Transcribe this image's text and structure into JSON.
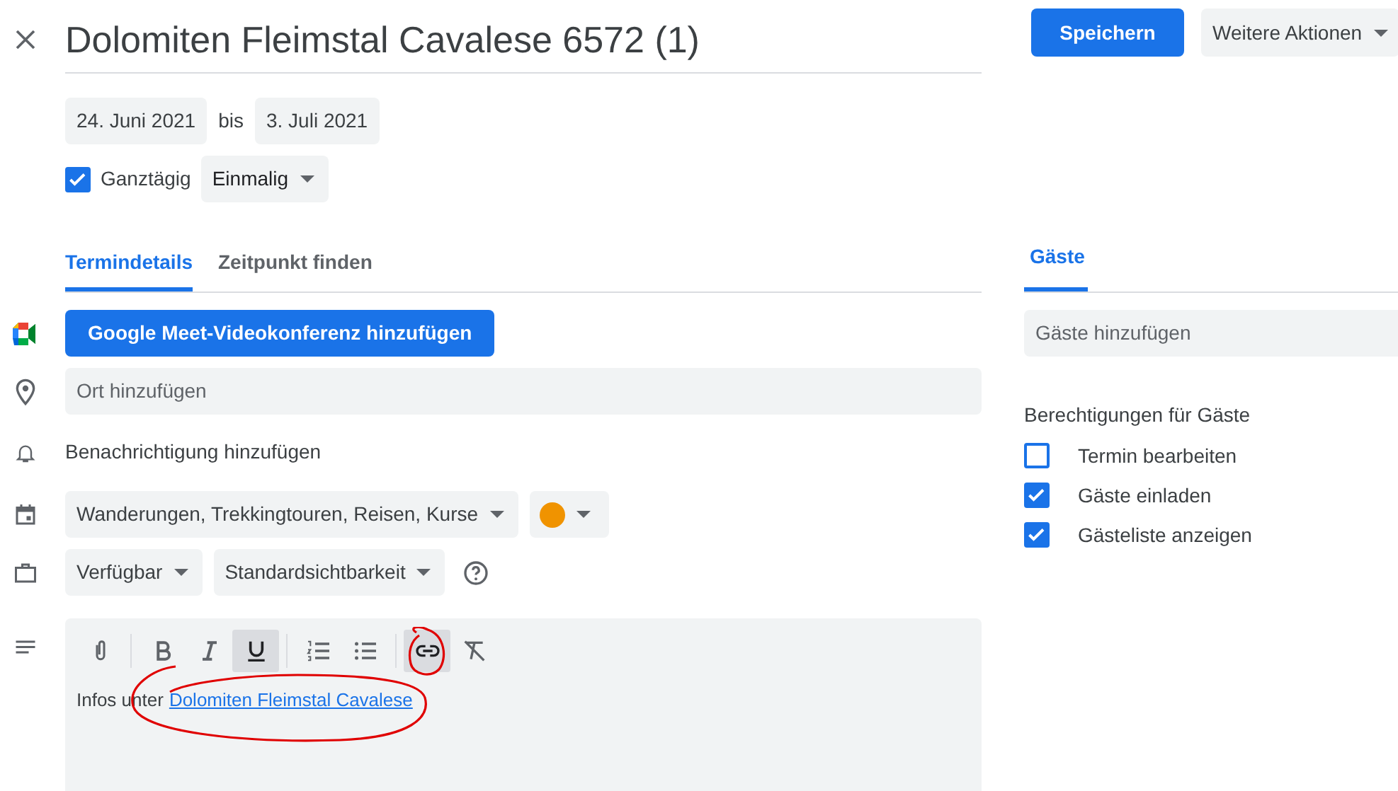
{
  "title": "Dolomiten Fleimstal Cavalese 6572 (1)",
  "header_buttons": {
    "save": "Speichern",
    "more": "Weitere Aktionen"
  },
  "dates": {
    "start": "24. Juni 2021",
    "separator": "bis",
    "end": "3. Juli 2021"
  },
  "all_day": {
    "label": "Ganztägig",
    "checked": true
  },
  "recurrence": "Einmalig",
  "tabs": [
    {
      "label": "Termindetails",
      "selected": true
    },
    {
      "label": "Zeitpunkt finden",
      "selected": false
    }
  ],
  "meet_button": "Google Meet-Videokonferenz hinzufügen",
  "location": {
    "placeholder": "Ort hinzufügen"
  },
  "notification": "Benachrichtigung hinzufügen",
  "calendar": {
    "name": "Wanderungen, Trekkingtouren, Reisen, Kurse",
    "color": "#f09300"
  },
  "availability": "Verfügbar",
  "visibility": "Standardsichtbarkeit",
  "toolbar": [
    {
      "kind": "attach",
      "selected": false
    },
    {
      "kind": "divider"
    },
    {
      "kind": "bold",
      "selected": false
    },
    {
      "kind": "italic",
      "selected": false
    },
    {
      "kind": "underline",
      "selected": true
    },
    {
      "kind": "divider"
    },
    {
      "kind": "numbered",
      "selected": false
    },
    {
      "kind": "bulleted",
      "selected": false
    },
    {
      "kind": "divider"
    },
    {
      "kind": "link",
      "selected": true
    },
    {
      "kind": "clear",
      "selected": false
    }
  ],
  "description": {
    "text": "Infos unter",
    "link": "Dolomiten Fleimstal Cavalese"
  },
  "guests": {
    "tab": "Gäste",
    "placeholder": "Gäste hinzufügen",
    "permissions_title": "Berechtigungen für Gäste",
    "permissions": [
      {
        "label": "Termin bearbeiten",
        "checked": false
      },
      {
        "label": "Gäste einladen",
        "checked": true
      },
      {
        "label": "Gästeliste anzeigen",
        "checked": true
      }
    ]
  }
}
